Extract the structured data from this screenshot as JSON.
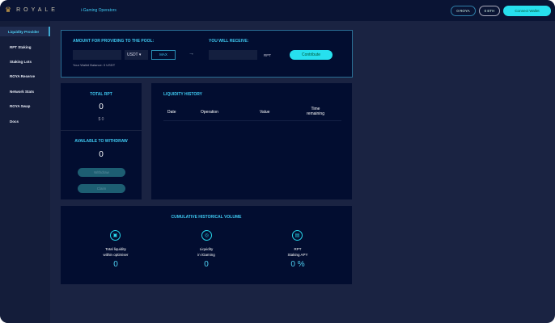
{
  "header": {
    "logo": "ROYALE",
    "nav_link": "i-Gaming Operators",
    "royа_balance": "0 ROYA",
    "eth_balance": "0 ETH",
    "connect": "Connect Wallet"
  },
  "sidebar": {
    "items": [
      {
        "label": "Liquidity Provider"
      },
      {
        "label": "RPT Staking"
      },
      {
        "label": "Staking Lots"
      },
      {
        "label": "ROYA Reserve"
      },
      {
        "label": "Network Stats"
      },
      {
        "label": "ROYA Swap"
      },
      {
        "label": "Docs"
      }
    ]
  },
  "pool": {
    "amount_label": "AMOUNT FOR PROVIDING TO THE POOL:",
    "currency": "USDT",
    "max": "MAX",
    "arrow": "→",
    "receive_label": "YOU WILL RECEIVE:",
    "receive_unit": "RPT",
    "contribute": "Contribute",
    "balance": "Your Wallet Balance: 0 USDT"
  },
  "total": {
    "title": "TOTAL RPT",
    "value": "0",
    "usd": "$ 0"
  },
  "withdraw": {
    "title": "AVAILABLE TO WITHDRAW",
    "value": "0",
    "withdraw_btn": "Withdraw",
    "claim_btn": "Claim"
  },
  "history": {
    "title": "LIQUIDITY HISTORY",
    "columns": [
      "Date",
      "Operation",
      "Value",
      "Time remaining"
    ]
  },
  "volume": {
    "title": "CUMULATIVE HISTORICAL VOLUME",
    "stats": [
      {
        "label1": "Total liquidity",
        "label2": "within optimiser",
        "value": "0",
        "icon": "vault-icon"
      },
      {
        "label1": "Liquidity",
        "label2": "in iGaming",
        "value": "0",
        "icon": "gamepad-icon"
      },
      {
        "label1": "RPT",
        "label2": "Staking APY",
        "value": "0 %",
        "icon": "document-icon"
      }
    ]
  }
}
